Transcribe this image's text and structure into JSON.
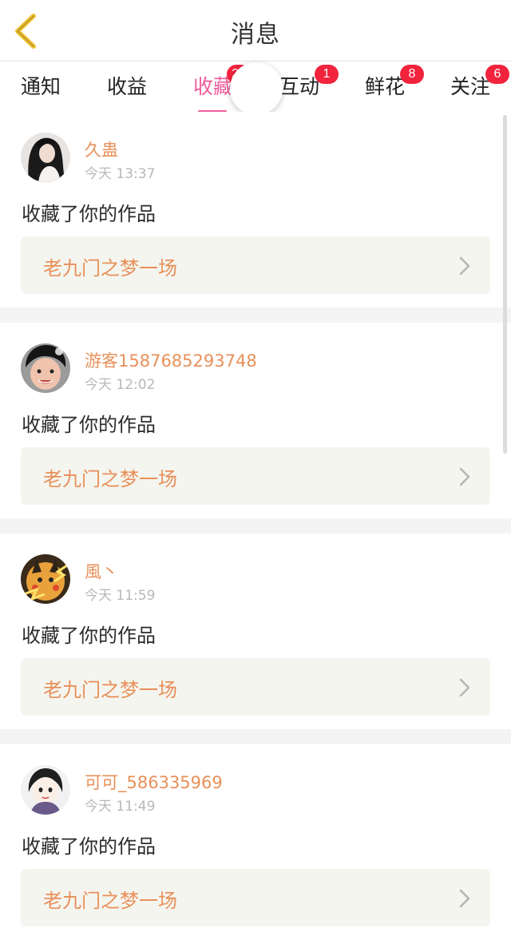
{
  "header": {
    "title": "消息",
    "back_icon": "chevron-left-icon",
    "accent": "#f1c232"
  },
  "tabs": [
    {
      "label": "通知",
      "badge": ""
    },
    {
      "label": "收益",
      "badge": ""
    },
    {
      "label": "收藏",
      "badge": "20",
      "active": true
    },
    {
      "label": "互动",
      "badge": "1"
    },
    {
      "label": "鲜花",
      "badge": "8"
    },
    {
      "label": "关注",
      "badge": "6"
    }
  ],
  "colors": {
    "active_tab": "#ef5c9c",
    "badge": "#f2233d",
    "username": "#e8905a",
    "work_title": "#e8905a"
  },
  "items": [
    {
      "username": "久蛊",
      "time": "今天 13:37",
      "action": "收藏了你的作品",
      "work": "老九门之梦一场"
    },
    {
      "username": "游客1587685293748",
      "time": "今天 12:02",
      "action": "收藏了你的作品",
      "work": "老九门之梦一场"
    },
    {
      "username": "風丶",
      "time": "今天 11:59",
      "action": "收藏了你的作品",
      "work": "老九门之梦一场"
    },
    {
      "username": "可可_586335969",
      "time": "今天 11:49",
      "action": "收藏了你的作品",
      "work": "老九门之梦一场"
    }
  ]
}
